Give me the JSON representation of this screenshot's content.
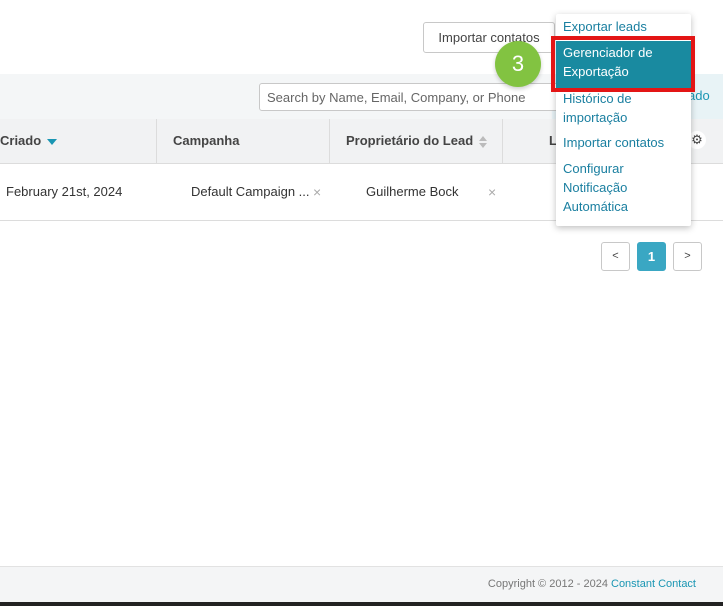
{
  "toolbar": {
    "import_button": "Importar contatos"
  },
  "search": {
    "placeholder": "Search by Name, Email, Company, or Phone",
    "advanced_link": "ado"
  },
  "table": {
    "headers": [
      "Criado",
      "Campanha",
      "Proprietário do Lead",
      "L"
    ],
    "rows": [
      {
        "created": "February 21st, 2024",
        "campaign": "Default Campaign ...",
        "owner": "Guilherme Bock",
        "remove_glyph": "×"
      }
    ]
  },
  "pagination": {
    "prev": "<",
    "current": "1",
    "next": ">"
  },
  "menu": {
    "items": [
      "Exportar leads",
      "Gerenciador de Exportação",
      "Histórico de importação",
      "Importar contatos",
      "Configurar Notificação Automática"
    ],
    "selected_index": 1
  },
  "step_badge": "3",
  "footer": {
    "copyright": "Copyright © 2012 - 2024 ",
    "brand_link": "Constant Contact"
  },
  "icons": {
    "settings": "gear-icon",
    "sort_active": "sort-down-icon",
    "sort_inactive": "sort-icon",
    "remove": "close-icon"
  },
  "colors": {
    "accent": "#1a96b3",
    "menu_selected": "#198aa0",
    "highlight_box": "#e31515",
    "step_badge": "#82c341",
    "page_active": "#3aa7c3"
  }
}
